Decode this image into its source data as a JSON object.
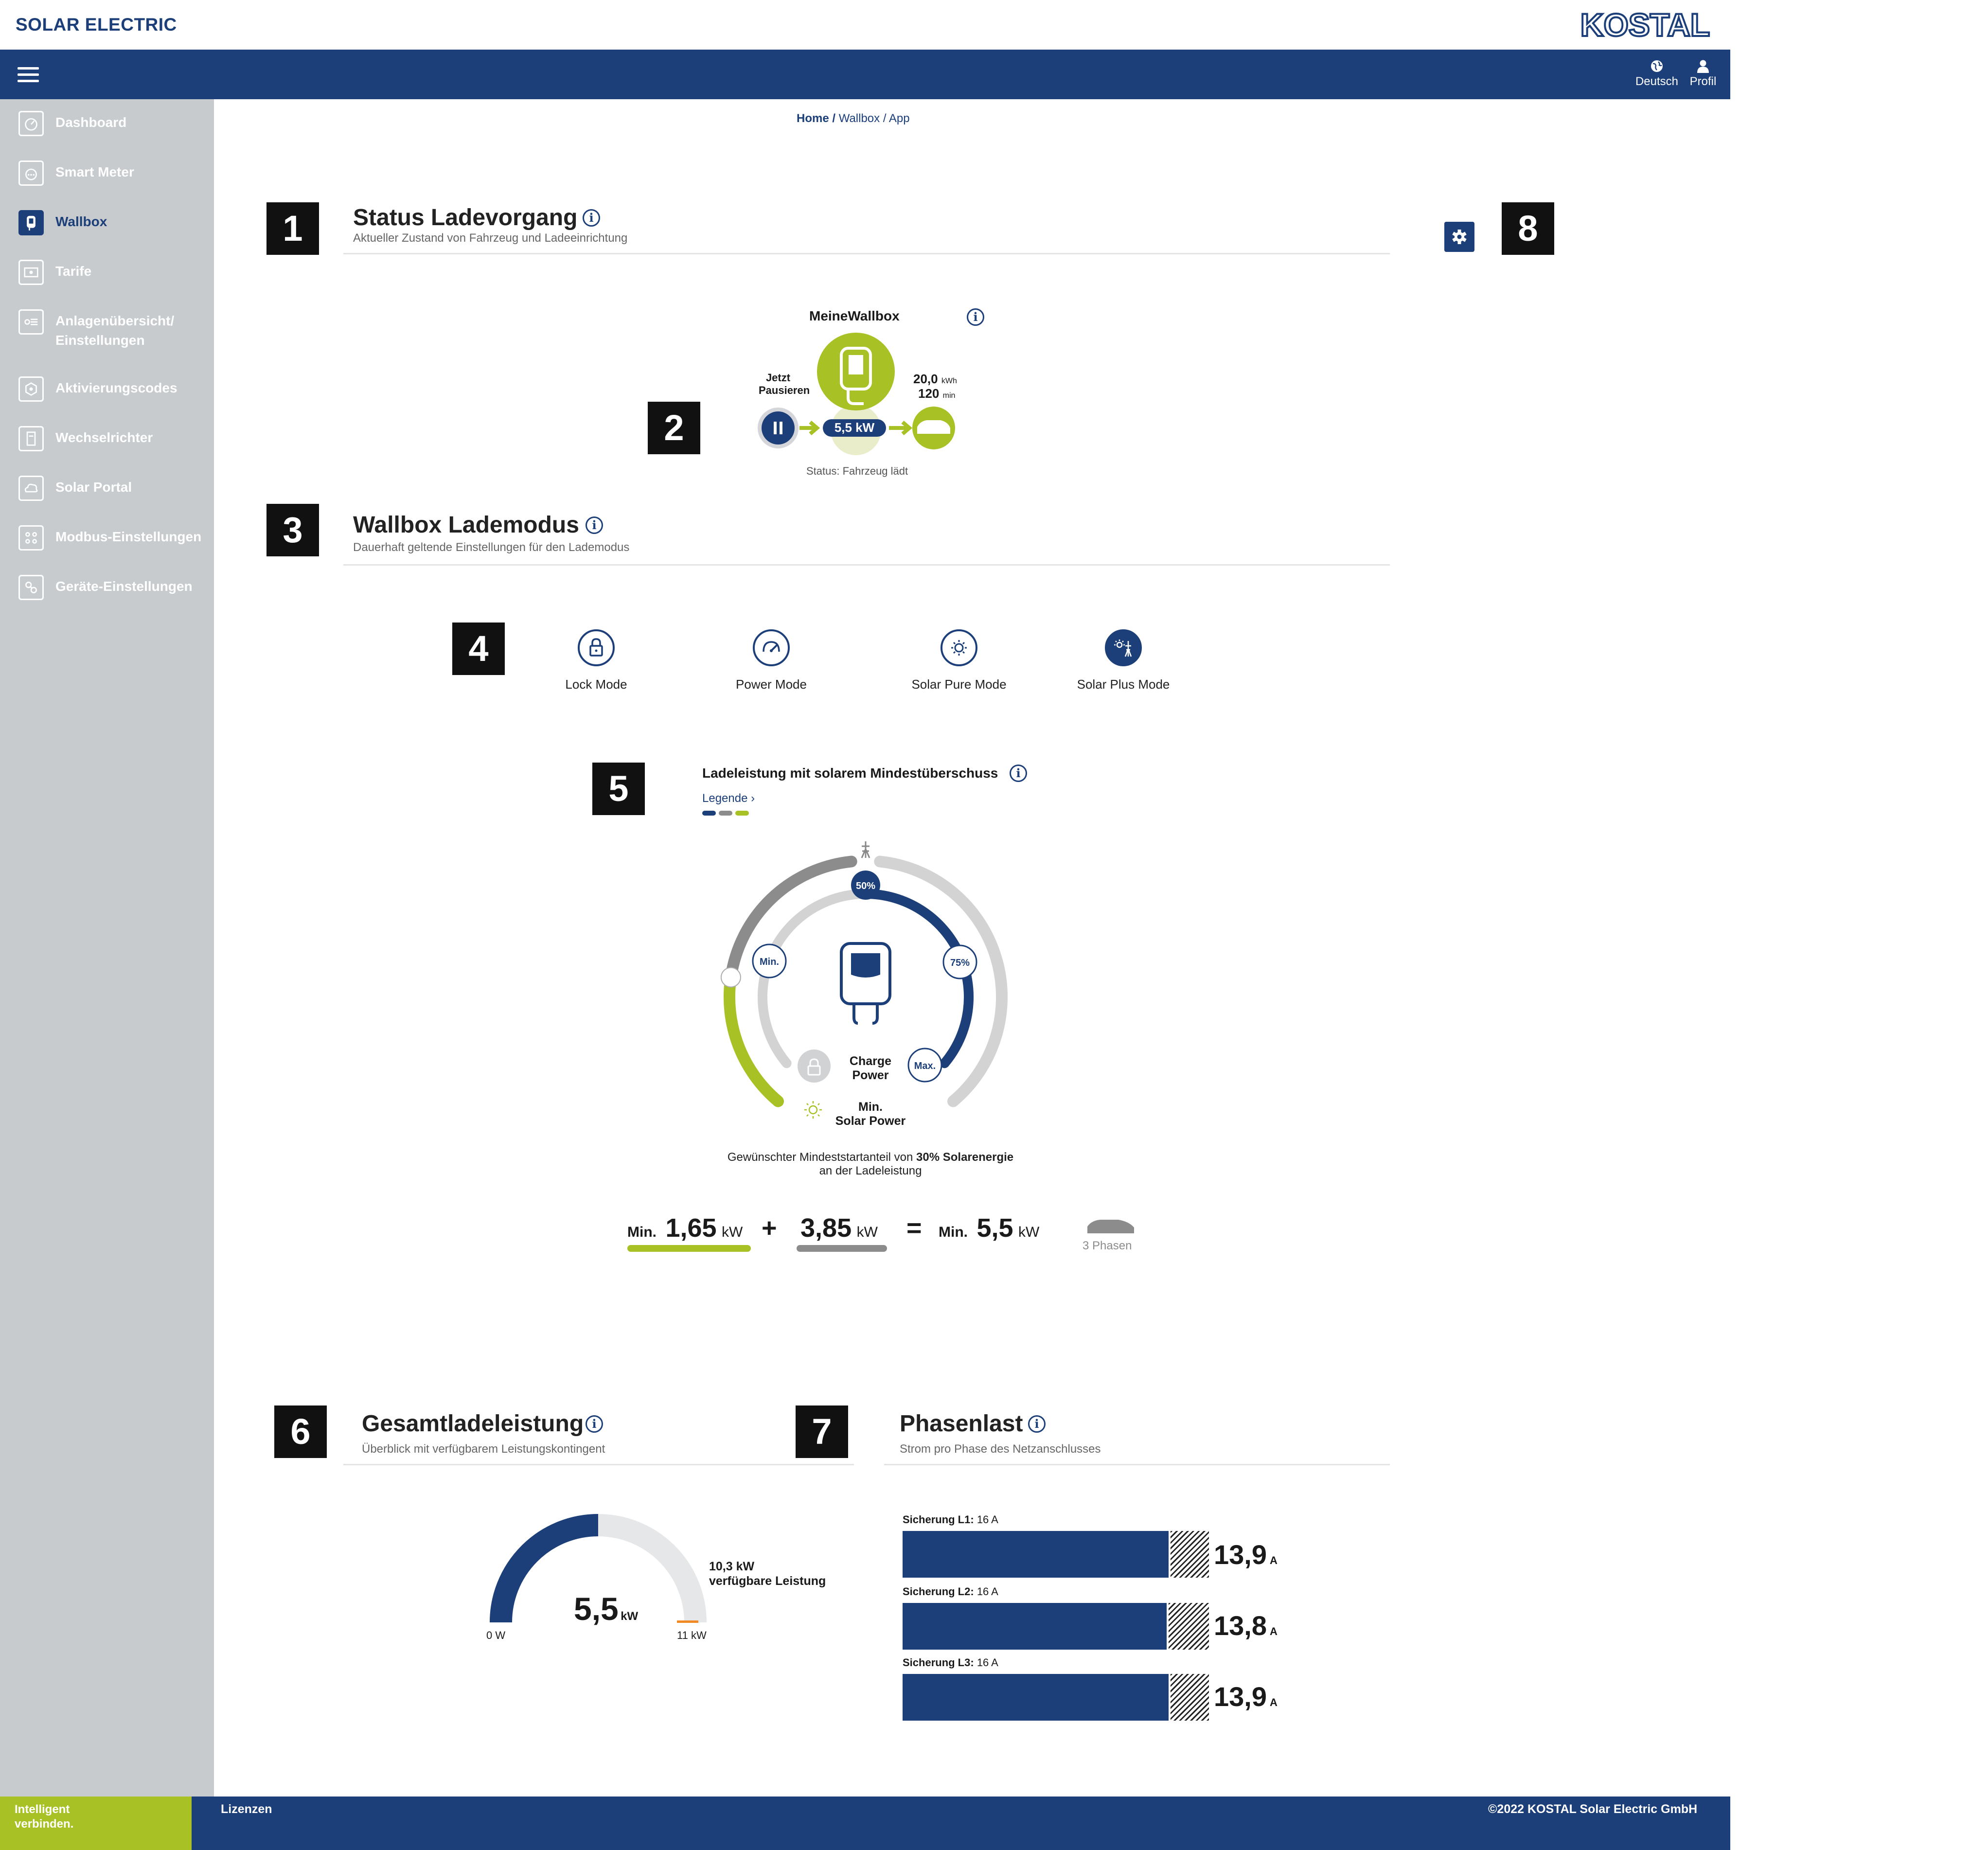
{
  "header": {
    "brand": "SOLAR ELECTRIC",
    "logo_text": "KOSTAL",
    "language": "Deutsch",
    "profile": "Profil"
  },
  "sidebar": {
    "items": [
      {
        "label": "Dashboard",
        "icon": "gauge-icon"
      },
      {
        "label": "Smart Meter",
        "icon": "meter-icon"
      },
      {
        "label": "Wallbox",
        "icon": "wallbox-icon",
        "active": true
      },
      {
        "label": "Tarife",
        "icon": "tariff-icon"
      },
      {
        "label": "Anlagenübersicht/",
        "label2": "Einstellungen",
        "icon": "overview-icon"
      },
      {
        "label": "Aktivierungscodes",
        "icon": "activation-code-icon"
      },
      {
        "label": "Wechselrichter",
        "icon": "inverter-icon"
      },
      {
        "label": "Solar Portal",
        "icon": "cloud-icon"
      },
      {
        "label": "Modbus-Einstellungen",
        "icon": "modbus-icon"
      },
      {
        "label": "Geräte-Einstellungen",
        "icon": "device-settings-icon"
      }
    ]
  },
  "breadcrumb": {
    "home": "Home /",
    "rest": "Wallbox / App"
  },
  "badges": [
    "1",
    "2",
    "3",
    "4",
    "5",
    "6",
    "7",
    "8"
  ],
  "status": {
    "title": "Status Ladevorgang",
    "subtitle": "Aktueller Zustand von Fahrzeug und Ladeeinrichtung",
    "wallbox_name": "MeineWallbox",
    "pause_line1": "Jetzt",
    "pause_line2": "Pausieren",
    "power": "5,5 kW",
    "energy_value": "20,0",
    "energy_unit": "kWh",
    "time_value": "120",
    "time_unit": "min",
    "status_text": "Status: Fahrzeug lädt"
  },
  "lademodus": {
    "title": "Wallbox Lademodus",
    "subtitle": "Dauerhaft geltende Einstellungen für den Lademodus",
    "modes": [
      {
        "label": "Lock Mode",
        "icon": "lock-icon"
      },
      {
        "label": "Power Mode",
        "icon": "power-gauge-icon"
      },
      {
        "label": "Solar Pure Mode",
        "icon": "sun-icon"
      },
      {
        "label": "Solar Plus Mode",
        "icon": "sun-grid-icon",
        "selected": true
      }
    ]
  },
  "ladeleistung": {
    "title": "Ladeleistung mit solarem Mindestüberschuss",
    "legend": "Legende",
    "legend_colors": [
      "#1c3f7a",
      "#8c8c8c",
      "#a8c124"
    ],
    "marker_50": "50%",
    "marker_75": "75%",
    "marker_min": "Min.",
    "marker_max": "Max.",
    "charge_power_1": "Charge",
    "charge_power_2": "Power",
    "solar_power_1": "Min.",
    "solar_power_2": "Solar Power",
    "desc_1": "Gewünschter Mindeststartanteil von ",
    "desc_bold": "30% Solarenergie",
    "desc_2": "an der Ladeleistung",
    "calc": {
      "min_label": "Min.",
      "solar_value": "1,65",
      "grid_value": "3,85",
      "total_label": "Min.",
      "total_value": "5,5",
      "unit": "kW",
      "plus": "+",
      "equals": "=",
      "phases": "3 Phasen"
    },
    "ring": {
      "outer_solar_fraction": 0.3,
      "inner_charge_fraction": 0.5,
      "colors": {
        "charge": "#1c3f7a",
        "grid": "#8c8c8c",
        "solar": "#a8c124",
        "track": "#d3d3d3"
      }
    }
  },
  "gesamt": {
    "title": "Gesamtladeleistung",
    "subtitle": "Überblick mit verfügbarem Leistungskontingent",
    "value": "5,5",
    "unit": "kW",
    "min_label": "0 W",
    "max_label": "11 kW",
    "available_value": "10,3 kW",
    "available_label": "verfügbare Leistung",
    "fraction": 0.5
  },
  "phasenlast": {
    "title": "Phasenlast",
    "subtitle": "Strom pro Phase des Netzanschlusses",
    "phases": [
      {
        "label": "Sicherung L1:",
        "fuse": "16 A",
        "value": "13,9",
        "unit": "A",
        "fraction": 0.869
      },
      {
        "label": "Sicherung L2:",
        "fuse": "16 A",
        "value": "13,8",
        "unit": "A",
        "fraction": 0.8625
      },
      {
        "label": "Sicherung L3:",
        "fuse": "16 A",
        "value": "13,9",
        "unit": "A",
        "fraction": 0.869
      }
    ]
  },
  "footer": {
    "slogan_1": "Intelligent",
    "slogan_2": "verbinden.",
    "licenses": "Lizenzen",
    "copyright": "©2022  KOSTAL Solar Electric GmbH"
  }
}
